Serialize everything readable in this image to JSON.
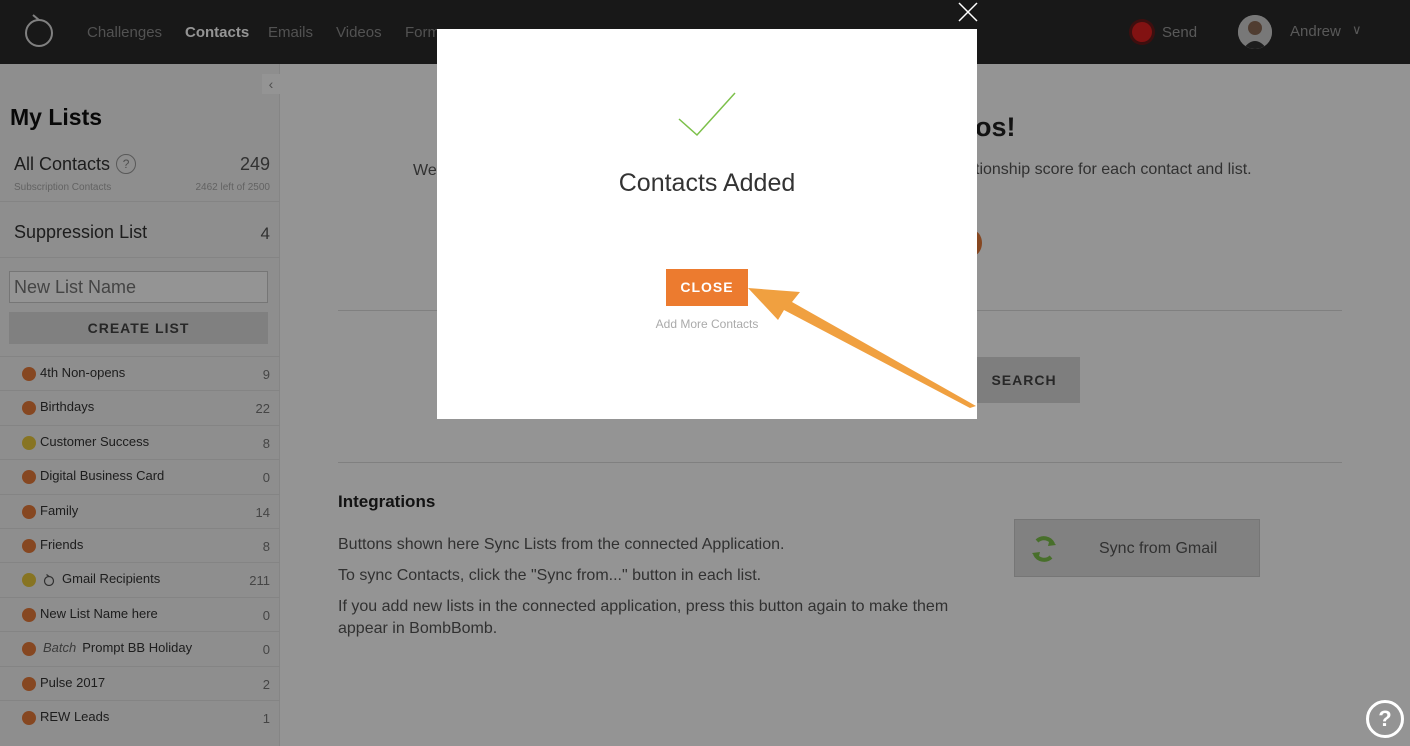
{
  "nav": {
    "links": [
      "Challenges",
      "Contacts",
      "Emails",
      "Videos",
      "Forms"
    ],
    "send_label": "Send",
    "user_name": "Andrew"
  },
  "sidebar": {
    "title": "My Lists",
    "all_contacts": {
      "label": "All Contacts",
      "count": "249",
      "subtitle": "Subscription Contacts",
      "remaining": "2462 left of 2500"
    },
    "suppression": {
      "label": "Suppression List",
      "count": "4"
    },
    "new_list_placeholder": "New List Name",
    "create_label": "CREATE LIST",
    "lists": [
      {
        "label": "4th Non-opens",
        "count": "9",
        "mood": "orange"
      },
      {
        "label": "Birthdays",
        "count": "22",
        "mood": "orange"
      },
      {
        "label": "Customer Success",
        "count": "8",
        "mood": "yellow"
      },
      {
        "label": "Digital Business Card",
        "count": "0",
        "mood": "orange"
      },
      {
        "label": "Family",
        "count": "14",
        "mood": "orange"
      },
      {
        "label": "Friends",
        "count": "8",
        "mood": "orange"
      },
      {
        "label": "Gmail Recipients",
        "count": "211",
        "mood": "yellow",
        "sync_icon": "sync-icon"
      },
      {
        "label": "New List Name here",
        "count": "0",
        "mood": "orange"
      },
      {
        "label": "Prompt BB Holiday",
        "count": "0",
        "mood": "orange",
        "prefix": "Batch"
      },
      {
        "label": "Pulse 2017",
        "count": "2",
        "mood": "orange"
      },
      {
        "label": "REW Leads",
        "count": "1",
        "mood": "orange"
      }
    ]
  },
  "main": {
    "hero_title_fragment": "os!",
    "hero_desc_left": "We",
    "hero_desc_right": "tionship score for each contact and list.",
    "search_label": "SEARCH",
    "integrations": {
      "title": "Integrations",
      "line1": "Buttons shown here Sync Lists from the connected Application.",
      "line2": "To sync Contacts, click the \"Sync from...\" button in each list.",
      "line3": "If you add new lists in the connected application, press this button again to make them appear in BombBomb.",
      "sync_label": "Sync from Gmail"
    },
    "help_label": "?"
  },
  "modal": {
    "title": "Contacts Added",
    "close_label": "CLOSE",
    "add_more_label": "Add More Contacts"
  },
  "colors": {
    "accent": "#ec7b2f",
    "nav_bg": "#2a2a2a",
    "check": "#7cc04a",
    "arrow": "#f0a040"
  }
}
